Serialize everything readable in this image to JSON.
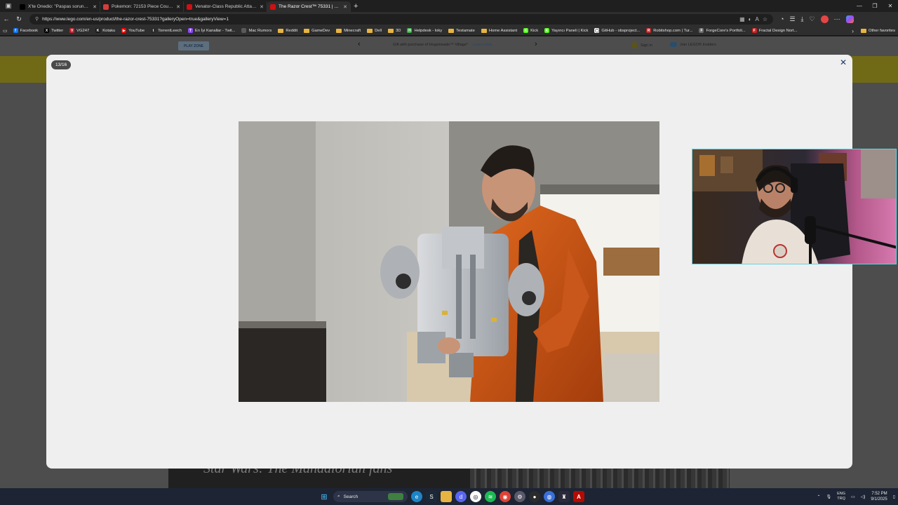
{
  "browser": {
    "tabs": [
      {
        "label": "X'te Onedio: \"Paspas sorununu çö",
        "favicon": "x-icon",
        "color": "#000000",
        "active": false
      },
      {
        "label": "Pokemon: 72153 Piece Count & P",
        "favicon": "pokemon-icon",
        "color": "#d63b3b",
        "active": false
      },
      {
        "label": "Venator-Class Republic Attack Cr",
        "favicon": "lego-icon",
        "color": "#d01012",
        "active": false
      },
      {
        "label": "The Razor Crest™ 75331 | Star Wa",
        "favicon": "lego-icon",
        "color": "#d01012",
        "active": true
      }
    ],
    "url": "https://www.lego.com/en-us/product/the-razor-crest-75331?galleryOpen=true&galleryView=1",
    "bookmarks": [
      {
        "label": "Facebook",
        "type": "site",
        "color": "#1877f2",
        "glyph": "f"
      },
      {
        "label": "Twitter",
        "type": "site",
        "color": "#000000",
        "glyph": "X"
      },
      {
        "label": "VG247",
        "type": "site",
        "color": "#c0212f",
        "glyph": "V"
      },
      {
        "label": "Kotaku",
        "type": "site",
        "color": "#1b1b1b",
        "glyph": "K"
      },
      {
        "label": "YouTube",
        "type": "site",
        "color": "#ff0000",
        "glyph": "▶"
      },
      {
        "label": "TorrentLeech",
        "type": "site",
        "color": "#2a2a2a",
        "glyph": "t"
      },
      {
        "label": "En İyi Kanallar - Twit...",
        "type": "site",
        "color": "#9146ff",
        "glyph": "T"
      },
      {
        "label": "Mac Rumors",
        "type": "site",
        "color": "#5a5a5a",
        "glyph": ""
      },
      {
        "label": "Reddit",
        "type": "folder"
      },
      {
        "label": "GameDev",
        "type": "folder"
      },
      {
        "label": "Minecraft",
        "type": "folder"
      },
      {
        "label": "Dell",
        "type": "folder"
      },
      {
        "label": "3D",
        "type": "folder"
      },
      {
        "label": "Helpdesk - loky",
        "type": "site",
        "color": "#3bb24a",
        "glyph": "H"
      },
      {
        "label": "Testamate",
        "type": "folder"
      },
      {
        "label": "Home Assistant",
        "type": "folder"
      },
      {
        "label": "Kick",
        "type": "site",
        "color": "#53fc18",
        "glyph": "K"
      },
      {
        "label": "Yayıncı Paneli | Kick",
        "type": "site",
        "color": "#53fc18",
        "glyph": "K"
      },
      {
        "label": "GitHub - obsproject...",
        "type": "site",
        "color": "#ffffff",
        "glyph": "◯"
      },
      {
        "label": "Robitshop.com | Tur...",
        "type": "site",
        "color": "#c02a2a",
        "glyph": "R"
      },
      {
        "label": "ForgeCore's Portfoli...",
        "type": "site",
        "color": "#6a6a6a",
        "glyph": "F"
      },
      {
        "label": "Fractal Design Nort...",
        "type": "site",
        "color": "#d02020",
        "glyph": "F"
      }
    ],
    "other_favorites": "Other favorites"
  },
  "lego_header": {
    "play_zone": "PLAY ZONE",
    "promo_text": "Gift with purchase of Hogsmeade™ Village*",
    "promo_link": "Learn more",
    "sign_in": "Sign in",
    "insiders": "Join LEGO® Insiders"
  },
  "background_hero_text": "Star Wars: The Mandalorian fans",
  "gallery": {
    "counter": "13/16",
    "close_glyph": "✕"
  },
  "taskbar": {
    "search_placeholder": "Search",
    "lang_line1": "ENG",
    "lang_line2": "TRQ",
    "time": "7:52 PM",
    "date": "9/1/2025"
  }
}
